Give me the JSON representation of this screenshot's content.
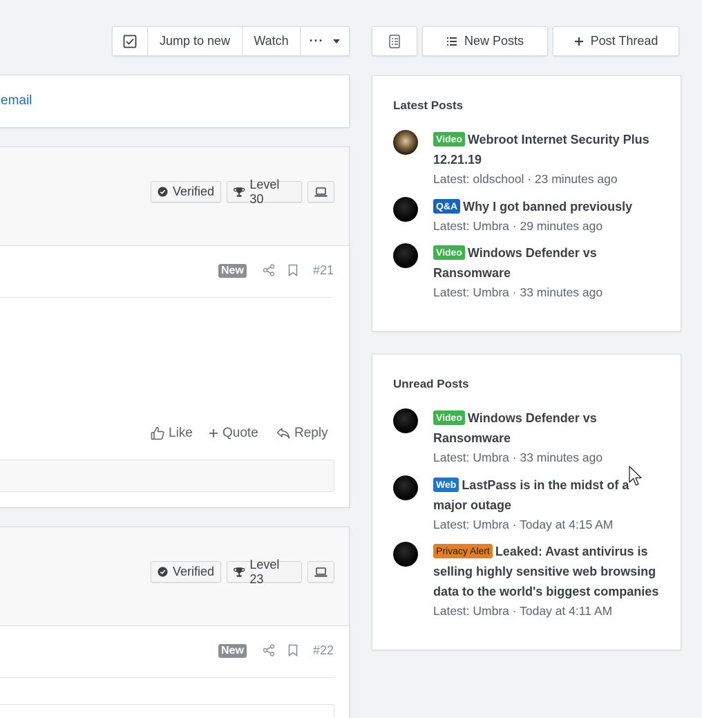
{
  "toolbar": {
    "jump_to_new": "Jump to new",
    "watch": "Watch",
    "new_posts": "New Posts",
    "post_thread": "Post Thread"
  },
  "notice": {
    "email_link": "email"
  },
  "posts": [
    {
      "verified": "Verified",
      "level": "Level 30",
      "badge": "New",
      "number": "#21",
      "actions": {
        "like": "Like",
        "quote": "Quote",
        "reply": "Reply"
      }
    },
    {
      "verified": "Verified",
      "level": "Level 23",
      "badge": "New",
      "number": "#22"
    }
  ],
  "latest_posts": {
    "title": "Latest Posts",
    "items": [
      {
        "tag": "Video",
        "tag_color": "#3cb44b",
        "title": "Webroot Internet Security Plus 12.21.19",
        "meta": "Latest: oldschool · 23 minutes ago"
      },
      {
        "tag": "Q&A",
        "tag_color": "#1565c0",
        "title": "Why I got banned previously",
        "meta": "Latest: Umbra · 29 minutes ago"
      },
      {
        "tag": "Video",
        "tag_color": "#3cb44b",
        "title": "Windows Defender vs Ransomware",
        "meta": "Latest: Umbra · 33 minutes ago"
      }
    ]
  },
  "unread_posts": {
    "title": "Unread Posts",
    "items": [
      {
        "tag": "Video",
        "tag_color": "#3cb44b",
        "title": "Windows Defender vs Ransomware",
        "meta": "Latest: Umbra · 33 minutes ago"
      },
      {
        "tag": "Web",
        "tag_color": "#1976d2",
        "title": "LastPass is in the midst of a major outage",
        "meta": "Latest: Umbra · Today at 4:15 AM"
      },
      {
        "tag": "Privacy Alert",
        "tag_color": "#e67e22",
        "title": "Leaked: Avast antivirus is selling highly sensitive web browsing data to the world's biggest companies",
        "meta": "Latest: Umbra · Today at 4:11 AM"
      }
    ]
  }
}
